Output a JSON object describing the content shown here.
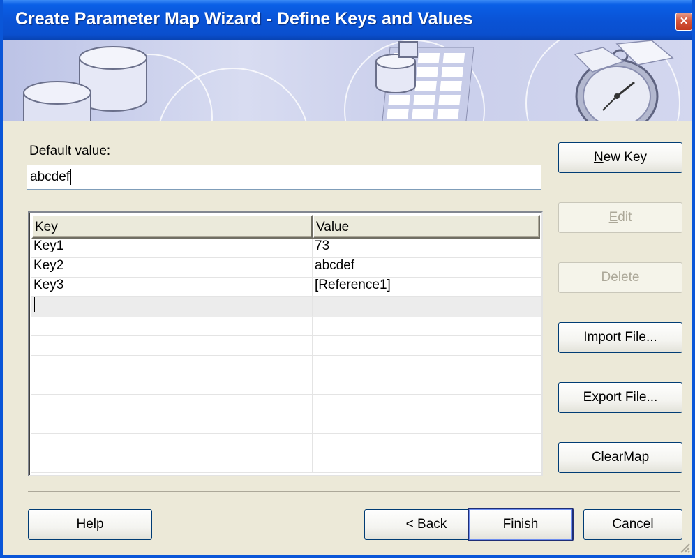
{
  "window": {
    "title": "Create Parameter Map Wizard - Define Keys and Values",
    "close_label": "×"
  },
  "default_value": {
    "label": "Default value:",
    "value": "abcdef"
  },
  "table": {
    "columns": [
      "Key",
      "Value"
    ],
    "rows": [
      {
        "key": "Key1",
        "value": "73"
      },
      {
        "key": "Key2",
        "value": "abcdef"
      },
      {
        "key": "Key3",
        "value": "[Reference1]"
      }
    ]
  },
  "side_buttons": {
    "new_key": {
      "pre": "",
      "u": "N",
      "post": "ew Key",
      "enabled": true
    },
    "edit": {
      "pre": "",
      "u": "E",
      "post": "dit",
      "enabled": false
    },
    "delete": {
      "pre": "",
      "u": "D",
      "post": "elete",
      "enabled": false
    },
    "import_file": {
      "pre": "",
      "u": "I",
      "post": "mport File...",
      "enabled": true
    },
    "export_file": {
      "pre": "E",
      "u": "x",
      "post": "port File...",
      "enabled": true
    },
    "clear_map": {
      "pre": "Clear ",
      "u": "M",
      "post": "ap",
      "enabled": true
    }
  },
  "footer_buttons": {
    "help": {
      "pre": "",
      "u": "H",
      "post": "elp"
    },
    "back": {
      "pre": "< ",
      "u": "B",
      "post": "ack"
    },
    "finish": {
      "pre": "",
      "u": "F",
      "post": "inish"
    },
    "cancel": {
      "pre": "",
      "u": "",
      "post": "Cancel"
    }
  },
  "colors": {
    "titlebar": "#0a53d6",
    "dialog_bg": "#ece9d8",
    "disabled_text": "#aca899"
  }
}
